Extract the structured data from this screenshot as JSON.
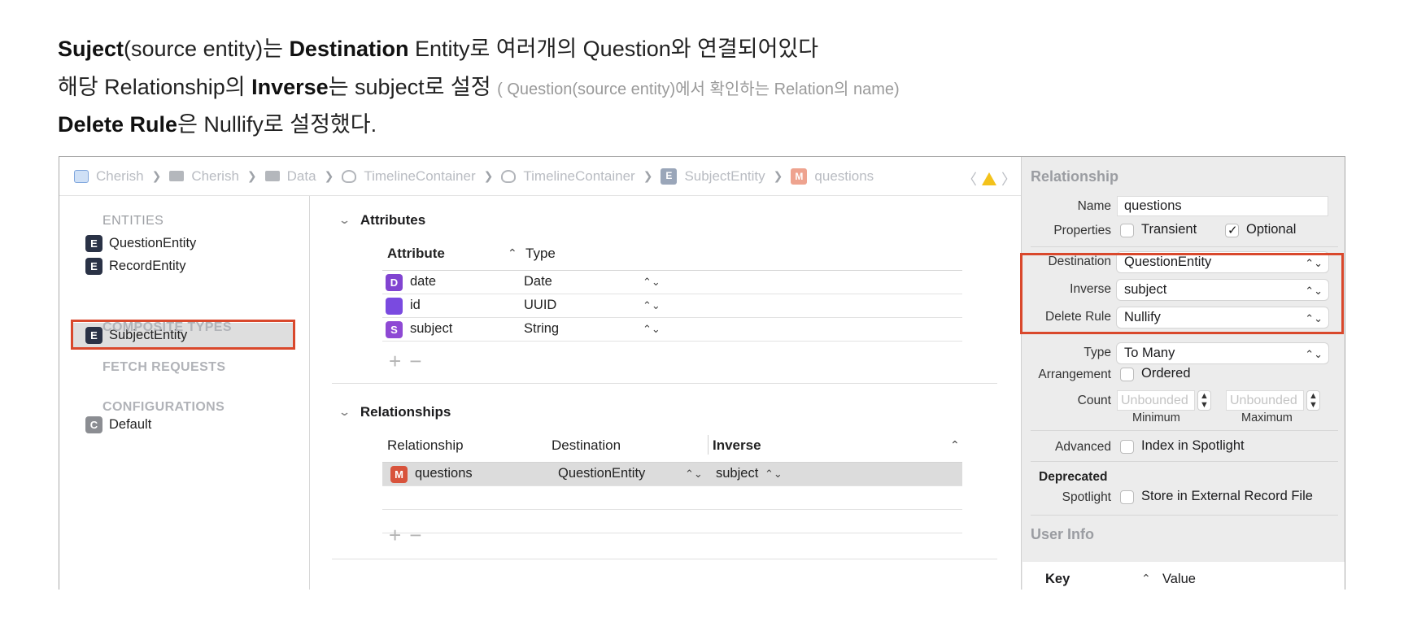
{
  "caption": {
    "line1": {
      "bold1": "Suject",
      "text1": "(source entity)는 ",
      "bold2": "Destination",
      "text2": " Entity로 여러개의 Question와 연결되어있다"
    },
    "line2": {
      "text1": "해당 Relationship의 ",
      "bold1": "Inverse",
      "text2": "는 subject로 설정 ",
      "small": "( Question(source entity)에서 확인하는 Relation의 name)"
    },
    "line3": {
      "bold1": "Delete Rule",
      "text1": "은 Nullify로 설정했다."
    }
  },
  "breadcrumb": [
    "Cherish",
    "Cherish",
    "Data",
    "TimelineContainer",
    "TimelineContainer",
    "SubjectEntity",
    "questions"
  ],
  "sidebar": {
    "entities_header": "ENTITIES",
    "entities": [
      "QuestionEntity",
      "RecordEntity",
      "SubjectEntity"
    ],
    "selected_entity": "SubjectEntity",
    "composite_header": "COMPOSITE TYPES",
    "fetch_header": "FETCH REQUESTS",
    "config_header": "CONFIGURATIONS",
    "configurations": [
      "Default"
    ],
    "badges": {
      "entity": "E",
      "config": "C"
    }
  },
  "attributes": {
    "title": "Attributes",
    "col_attribute": "Attribute",
    "col_type": "Type",
    "rows": [
      {
        "badge": "D",
        "name": "date",
        "type": "Date"
      },
      {
        "badge": "",
        "name": "id",
        "type": "UUID"
      },
      {
        "badge": "S",
        "name": "subject",
        "type": "String"
      }
    ]
  },
  "relationships": {
    "title": "Relationships",
    "col_relationship": "Relationship",
    "col_destination": "Destination",
    "col_inverse": "Inverse",
    "rows": [
      {
        "badge": "M",
        "name": "questions",
        "destination": "QuestionEntity",
        "inverse": "subject"
      }
    ]
  },
  "inspector": {
    "title": "Relationship",
    "name_label": "Name",
    "name_value": "questions",
    "properties_label": "Properties",
    "transient_label": "Transient",
    "transient_checked": false,
    "optional_label": "Optional",
    "optional_checked": true,
    "destination_label": "Destination",
    "destination_value": "QuestionEntity",
    "inverse_label": "Inverse",
    "inverse_value": "subject",
    "delete_rule_label": "Delete Rule",
    "delete_rule_value": "Nullify",
    "type_label": "Type",
    "type_value": "To Many",
    "arrangement_label": "Arrangement",
    "ordered_label": "Ordered",
    "count_label": "Count",
    "count_min_placeholder": "Unbounded",
    "count_max_placeholder": "Unbounded",
    "minimum_label": "Minimum",
    "maximum_label": "Maximum",
    "advanced_label": "Advanced",
    "index_spotlight_label": "Index in Spotlight",
    "deprecated_label": "Deprecated",
    "spotlight_label": "Spotlight",
    "store_external_label": "Store in External Record File",
    "user_info_title": "User Info",
    "key_col": "Key",
    "value_col": "Value"
  },
  "colors": {
    "highlight_box": "#d9482c",
    "entity_badge": "#2a3246",
    "many_badge": "#d8533c"
  }
}
